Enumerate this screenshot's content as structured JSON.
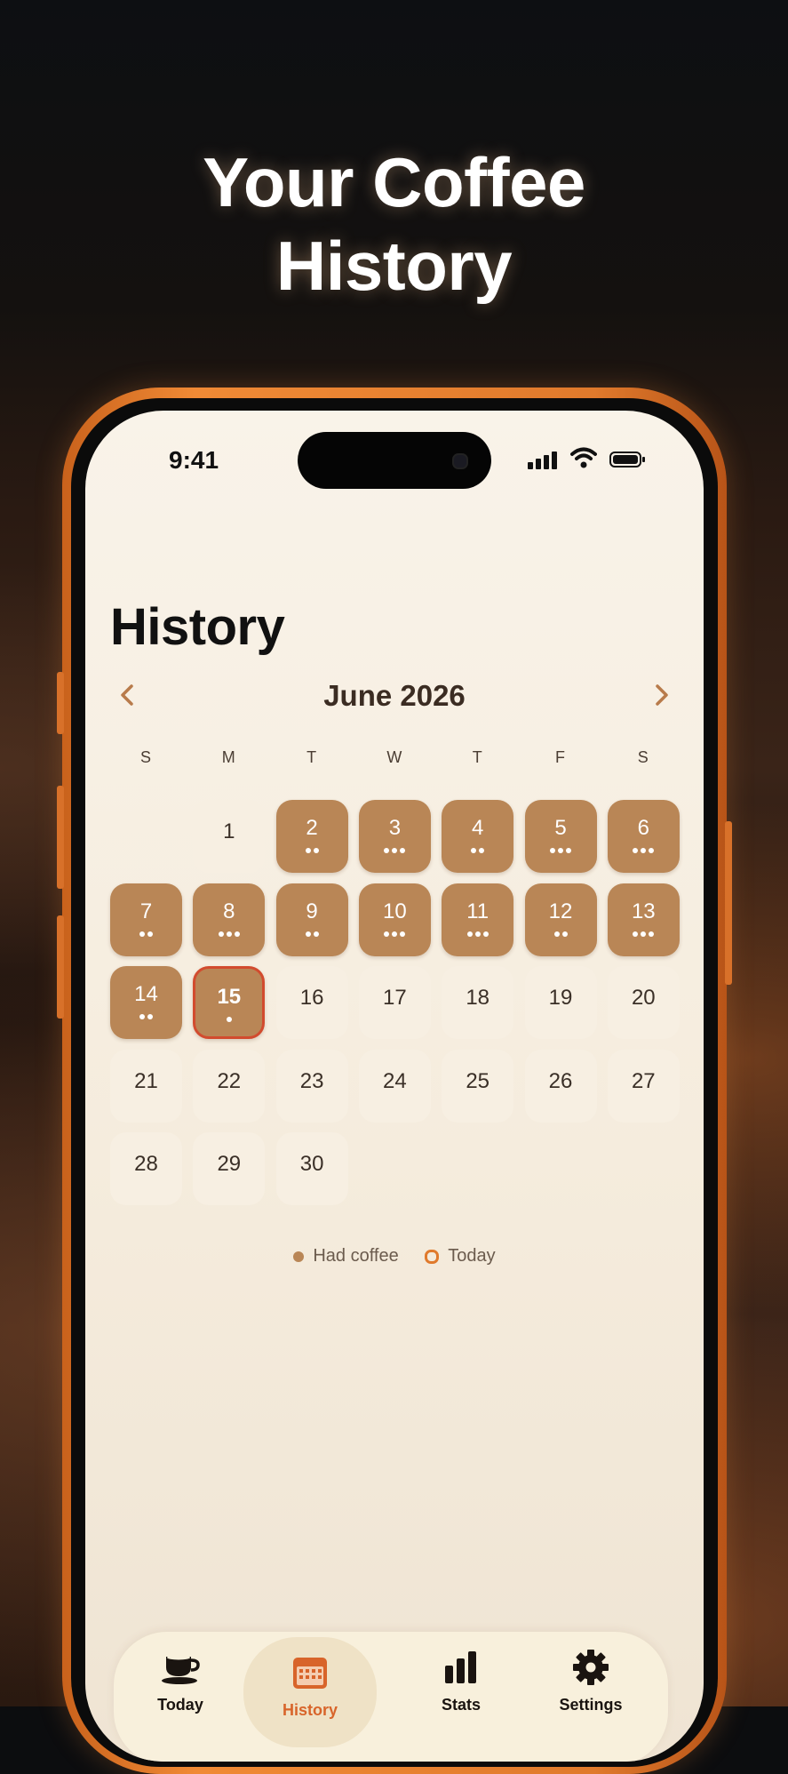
{
  "headline": {
    "line1": "Your Coffee",
    "line2": "History"
  },
  "status_bar": {
    "time": "9:41"
  },
  "page": {
    "title": "History"
  },
  "calendar": {
    "month_label": "June 2026",
    "prev_icon": "chevron-left-icon",
    "next_icon": "chevron-right-icon",
    "weekdays": [
      "S",
      "M",
      "T",
      "W",
      "T",
      "F",
      "S"
    ],
    "days": [
      {
        "d": "1",
        "coffee": false,
        "dots": 0
      },
      {
        "d": "2",
        "coffee": true,
        "dots": 2
      },
      {
        "d": "3",
        "coffee": true,
        "dots": 3
      },
      {
        "d": "4",
        "coffee": true,
        "dots": 2
      },
      {
        "d": "5",
        "coffee": true,
        "dots": 3
      },
      {
        "d": "6",
        "coffee": true,
        "dots": 3
      },
      {
        "d": "7",
        "coffee": true,
        "dots": 2
      },
      {
        "d": "8",
        "coffee": true,
        "dots": 3
      },
      {
        "d": "9",
        "coffee": true,
        "dots": 2
      },
      {
        "d": "10",
        "coffee": true,
        "dots": 3
      },
      {
        "d": "11",
        "coffee": true,
        "dots": 3
      },
      {
        "d": "12",
        "coffee": true,
        "dots": 2
      },
      {
        "d": "13",
        "coffee": true,
        "dots": 3
      },
      {
        "d": "14",
        "coffee": true,
        "dots": 2
      },
      {
        "d": "15",
        "coffee": true,
        "dots": 1,
        "today": true
      },
      {
        "d": "16",
        "coffee": false,
        "dots": 0
      },
      {
        "d": "17",
        "coffee": false,
        "dots": 0
      },
      {
        "d": "18",
        "coffee": false,
        "dots": 0
      },
      {
        "d": "19",
        "coffee": false,
        "dots": 0
      },
      {
        "d": "20",
        "coffee": false,
        "dots": 0
      },
      {
        "d": "21",
        "coffee": false,
        "dots": 0
      },
      {
        "d": "22",
        "coffee": false,
        "dots": 0
      },
      {
        "d": "23",
        "coffee": false,
        "dots": 0
      },
      {
        "d": "24",
        "coffee": false,
        "dots": 0
      },
      {
        "d": "25",
        "coffee": false,
        "dots": 0
      },
      {
        "d": "26",
        "coffee": false,
        "dots": 0
      },
      {
        "d": "27",
        "coffee": false,
        "dots": 0
      },
      {
        "d": "28",
        "coffee": false,
        "dots": 0
      },
      {
        "d": "29",
        "coffee": false,
        "dots": 0
      },
      {
        "d": "30",
        "coffee": false,
        "dots": 0
      }
    ],
    "first_weekday_index": 1
  },
  "legend": {
    "had_coffee": "Had coffee",
    "today": "Today"
  },
  "tabs": [
    {
      "label": "Today",
      "icon": "coffee-cup-icon",
      "active": false
    },
    {
      "label": "History",
      "icon": "calendar-icon",
      "active": true
    },
    {
      "label": "Stats",
      "icon": "bar-chart-icon",
      "active": false
    },
    {
      "label": "Settings",
      "icon": "gear-icon",
      "active": false
    }
  ],
  "colors": {
    "accent": "#E07A2C",
    "coffee_day": "#B98656",
    "today_ring": "#D24B2E"
  }
}
